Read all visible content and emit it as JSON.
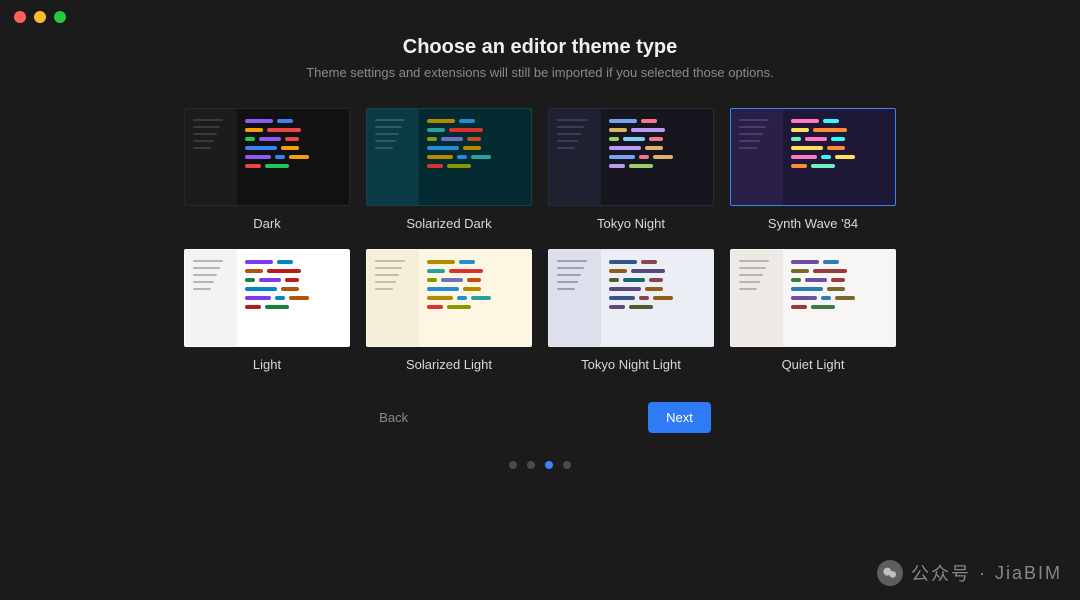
{
  "heading": "Choose an editor theme type",
  "subheading": "Theme settings and extensions will still be imported if you selected those options.",
  "themes": [
    {
      "name": "Dark",
      "selected": false,
      "bg": "#161616",
      "sidebar_bg": "#1c1c1c",
      "editor_bg": "#111111",
      "side_line": "#3a3a3a",
      "tokens": [
        "#8b5cf6",
        "#3b82f6",
        "#f59e0b",
        "#ef4444",
        "#22c55e",
        "#8b5cf6",
        "#ef4444",
        "#3b82f6",
        "#f59e0b"
      ]
    },
    {
      "name": "Solarized Dark",
      "selected": false,
      "bg": "#07303a",
      "sidebar_bg": "#0a3a44",
      "editor_bg": "#042a32",
      "side_line": "#2f5a62",
      "tokens": [
        "#b58900",
        "#268bd2",
        "#2aa198",
        "#dc322f",
        "#859900",
        "#6c71c4",
        "#cb4b16",
        "#268bd2",
        "#b58900"
      ]
    },
    {
      "name": "Tokyo Night",
      "selected": false,
      "bg": "#1a1b26",
      "sidebar_bg": "#1f2030",
      "editor_bg": "#16161e",
      "side_line": "#3b3d57",
      "tokens": [
        "#7aa2f7",
        "#f7768e",
        "#e0af68",
        "#bb9af7",
        "#9ece6a",
        "#7dcfff",
        "#f7768e",
        "#bb9af7",
        "#e0af68"
      ]
    },
    {
      "name": "Synth Wave '84",
      "selected": true,
      "bg": "#241b3a",
      "sidebar_bg": "#2a2046",
      "editor_bg": "#1e1736",
      "side_line": "#4a3d6e",
      "tokens": [
        "#ff79c6",
        "#36f9f6",
        "#fede5d",
        "#ff8b39",
        "#72f1b8",
        "#ff79c6",
        "#36f9f6",
        "#fede5d",
        "#ff8b39"
      ]
    },
    {
      "name": "Light",
      "selected": false,
      "bg": "#ffffff",
      "sidebar_bg": "#f3f3f3",
      "editor_bg": "#ffffff",
      "side_line": "#b5b5b5",
      "tokens": [
        "#7c3aed",
        "#0284c7",
        "#b45309",
        "#b91c1c",
        "#15803d",
        "#7c3aed",
        "#b91c1c",
        "#0284c7",
        "#b45309"
      ]
    },
    {
      "name": "Solarized Light",
      "selected": false,
      "bg": "#fdf6e3",
      "sidebar_bg": "#f5eed9",
      "editor_bg": "#fdf6e3",
      "side_line": "#c8bfa3",
      "tokens": [
        "#b58900",
        "#268bd2",
        "#2aa198",
        "#dc322f",
        "#859900",
        "#6c71c4",
        "#cb4b16",
        "#268bd2",
        "#b58900"
      ]
    },
    {
      "name": "Tokyo Night Light",
      "selected": false,
      "bg": "#e5e7ef",
      "sidebar_bg": "#dde0ea",
      "editor_bg": "#eceef5",
      "side_line": "#9aa0b2",
      "tokens": [
        "#34548a",
        "#8c4351",
        "#8f5e15",
        "#5a4a78",
        "#485e30",
        "#166775",
        "#8c4351",
        "#5a4a78",
        "#8f5e15"
      ]
    },
    {
      "name": "Quiet Light",
      "selected": false,
      "bg": "#f6f4f2",
      "sidebar_bg": "#edeae6",
      "editor_bg": "#f8f6f4",
      "side_line": "#b8b3ac",
      "tokens": [
        "#6a4fa3",
        "#2d7ab8",
        "#7a6a2a",
        "#9a3b3b",
        "#3d7a3d",
        "#6a4fa3",
        "#9a3b3b",
        "#2d7ab8",
        "#7a6a2a"
      ]
    }
  ],
  "buttons": {
    "back": "Back",
    "next": "Next"
  },
  "pager": {
    "count": 4,
    "active_index": 2
  },
  "watermark": {
    "label": "公众号",
    "name": "JiaBIM",
    "separator": "·"
  }
}
